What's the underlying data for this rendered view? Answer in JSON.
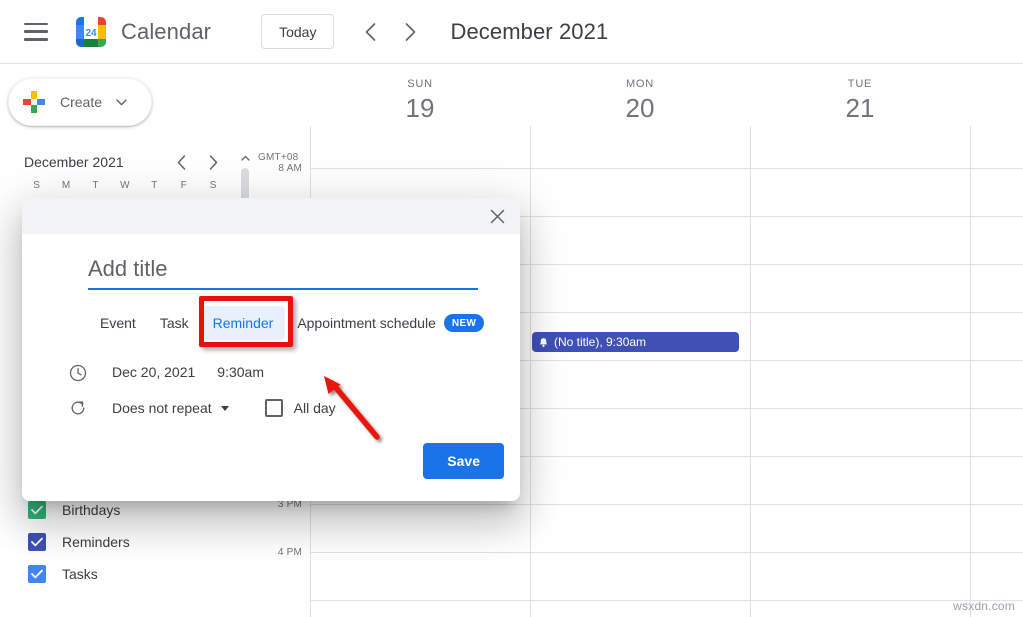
{
  "topbar": {
    "menu_icon": "hamburger-icon",
    "logo_icon": "google-calendar-logo",
    "logo_day_number": "24",
    "brand": "Calendar",
    "today_label": "Today",
    "prev_icon": "chevron-left-icon",
    "next_icon": "chevron-right-icon",
    "month_title": "December 2021"
  },
  "sidebar": {
    "create_label": "Create",
    "create_plus_icon": "google-plus-icon",
    "create_caret_icon": "chevron-down-icon",
    "mini_calendar": {
      "month_title": "December 2021",
      "prev_icon": "chevron-left-icon",
      "next_icon": "chevron-right-icon",
      "day_initials": [
        "S",
        "M",
        "T",
        "W",
        "T",
        "F",
        "S"
      ]
    },
    "scroll_up_icon": "chevron-up-icon",
    "calendars": [
      {
        "label": "Birthdays",
        "color": "#33b679",
        "checked": true
      },
      {
        "label": "Reminders",
        "color": "#3f51b5",
        "checked": true
      },
      {
        "label": "Tasks",
        "color": "#4285f4",
        "checked": true
      }
    ]
  },
  "grid": {
    "timezone": "GMT+08",
    "days": [
      {
        "dow": "SUN",
        "num": "19"
      },
      {
        "dow": "MON",
        "num": "20"
      },
      {
        "dow": "TUE",
        "num": "21"
      }
    ],
    "hour_labels": [
      "8 AM",
      "3 PM",
      "4 PM"
    ],
    "events": [
      {
        "title": "(No title), 9:30am",
        "color": "#3f51b5",
        "icon": "reminder-bell-icon",
        "day": "MON",
        "time": "9:30am"
      }
    ]
  },
  "dialog": {
    "close_icon": "close-icon",
    "title_placeholder": "Add title",
    "title_value": "",
    "tabs": [
      {
        "label": "Event",
        "selected": false
      },
      {
        "label": "Task",
        "selected": false
      },
      {
        "label": "Reminder",
        "selected": true
      },
      {
        "label": "Appointment schedule",
        "selected": false,
        "badge": "NEW"
      }
    ],
    "clock_icon": "clock-icon",
    "date_value": "Dec 20, 2021",
    "time_value": "9:30am",
    "repeat_icon": "repeat-icon",
    "repeat_value": "Does not repeat",
    "allday_label": "All day",
    "allday_checked": false,
    "save_label": "Save"
  },
  "annotations": {
    "highlight_color": "#e8120c",
    "highlight_target": "Reminder",
    "arrow_color": "#e8120c"
  },
  "watermark": "wsxdn.com"
}
